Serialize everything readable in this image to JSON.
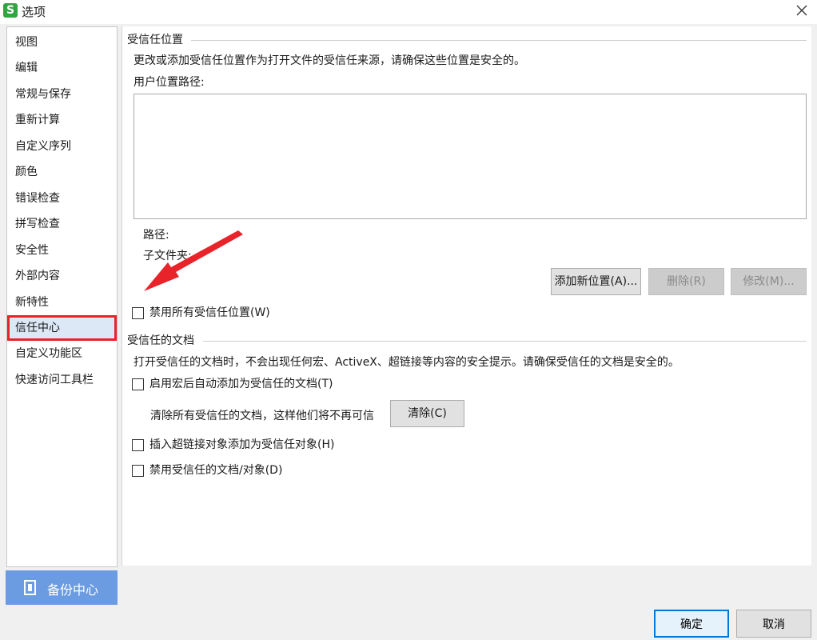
{
  "window": {
    "title": "选项",
    "logo_letter": "S"
  },
  "sidebar": {
    "items": [
      {
        "label": "视图"
      },
      {
        "label": "编辑"
      },
      {
        "label": "常规与保存"
      },
      {
        "label": "重新计算"
      },
      {
        "label": "自定义序列"
      },
      {
        "label": "颜色"
      },
      {
        "label": "错误检查"
      },
      {
        "label": "拼写检查"
      },
      {
        "label": "安全性"
      },
      {
        "label": "外部内容"
      },
      {
        "label": "新特性"
      },
      {
        "label": "信任中心",
        "selected": true
      },
      {
        "label": "自定义功能区"
      },
      {
        "label": "快速访问工具栏"
      }
    ]
  },
  "backup": {
    "label": "备份中心"
  },
  "trusted_locations": {
    "header": "受信任位置",
    "description": "更改或添加受信任位置作为打开文件的受信任来源，请确保这些位置是安全的。",
    "user_path_label": "用户位置路径:",
    "path_label": "路径:",
    "subfolder_label": "子文件夹:",
    "add_button": "添加新位置(A)...",
    "delete_button": "删除(R)",
    "modify_button": "修改(M)...",
    "disable_all_checkbox": "禁用所有受信任位置(W)"
  },
  "trusted_documents": {
    "header": "受信任的文档",
    "description": "打开受信任的文档时，不会出现任何宏、ActiveX、超链接等内容的安全提示。请确保受信任的文档是安全的。",
    "auto_add_checkbox": "启用宏后自动添加为受信任的文档(T)",
    "clear_text": "清除所有受信任的文档，这样他们将不再可信",
    "clear_button": "清除(C)",
    "hyperlink_checkbox": "插入超链接对象添加为受信任对象(H)",
    "disable_checkbox": "禁用受信任的文档/对象(D)"
  },
  "footer": {
    "ok": "确定",
    "cancel": "取消"
  },
  "colors": {
    "accent_red": "#e8232a",
    "selection_bg": "#dce8f6",
    "backup_blue": "#6b9be0",
    "focus_blue": "#0078d7"
  }
}
